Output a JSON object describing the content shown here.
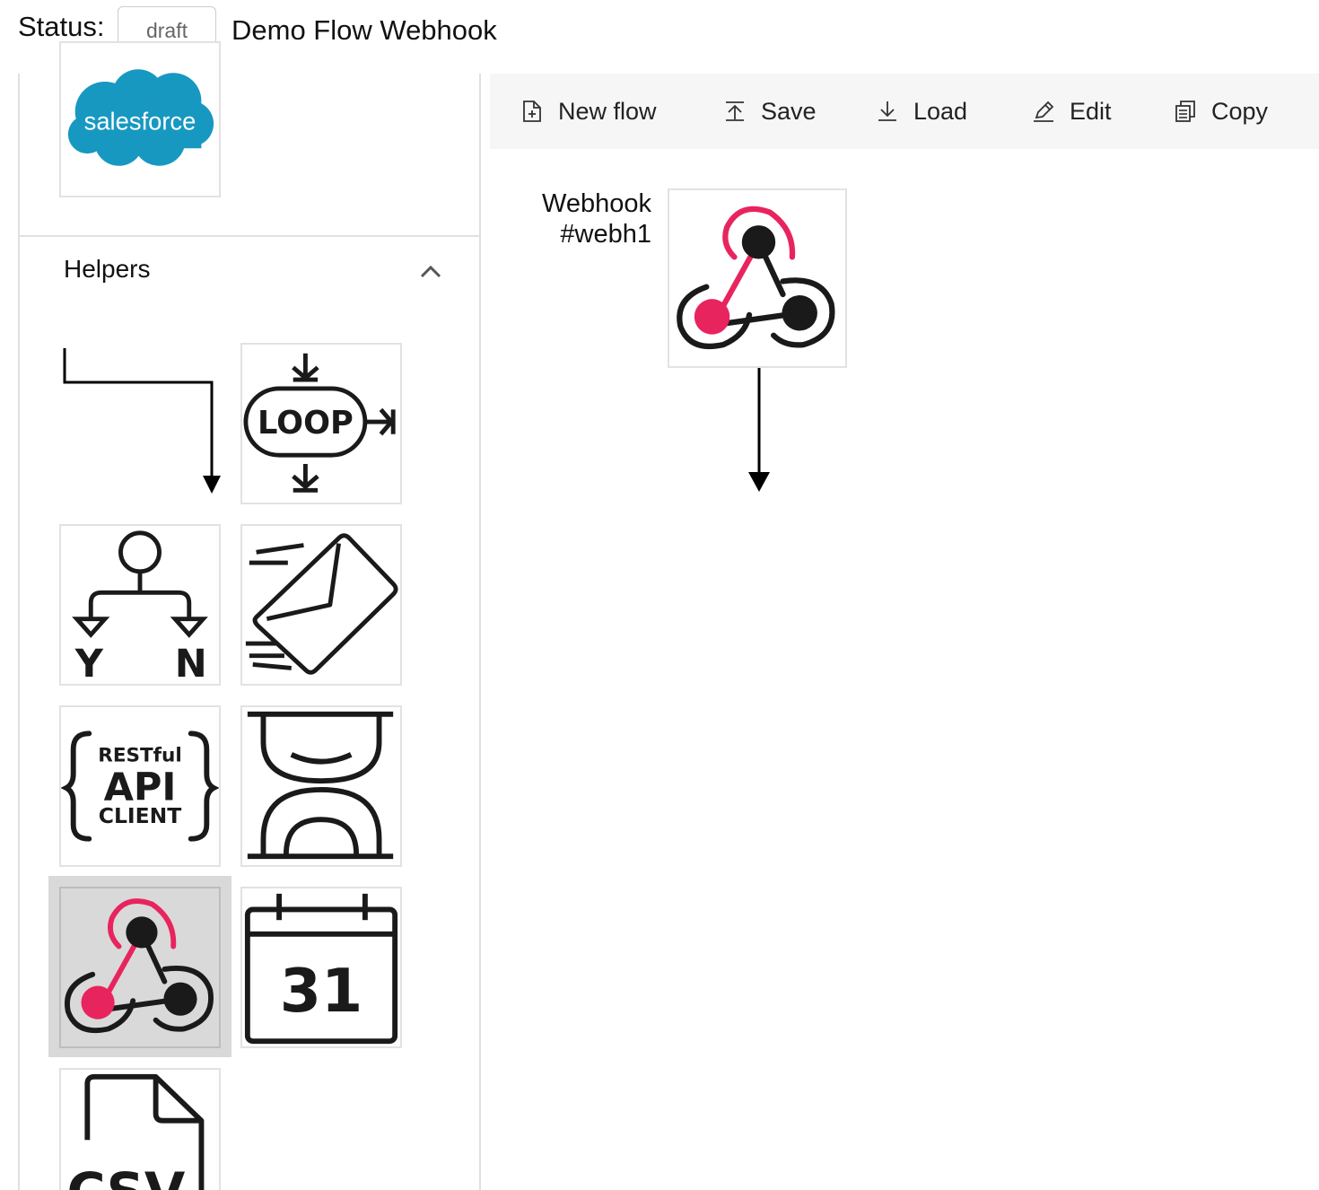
{
  "header": {
    "status_label": "Status:",
    "status_value": "draft",
    "flow_title": "Demo Flow Webhook"
  },
  "sidebar": {
    "section_title": "Helpers",
    "salesforce_logo_text": "salesforce",
    "tiles": {
      "loop_text": "LOOP",
      "branch_yes": "Y",
      "branch_no": "N",
      "api_line1": "RESTful",
      "api_line2": "API",
      "api_line3": "CLIENT",
      "calendar_day": "31",
      "csv_text": "CSV"
    }
  },
  "toolbar": {
    "new_flow": "New flow",
    "save": "Save",
    "load": "Load",
    "edit": "Edit",
    "copy": "Copy"
  },
  "canvas": {
    "node": {
      "label_line1": "Webhook",
      "label_line2": "#webh1"
    }
  },
  "colors": {
    "salesforce_blue": "#1798c1",
    "webhook_pink": "#e8245e",
    "webhook_dark": "#1a1a1a",
    "selected_tile": "#d9d9d9"
  }
}
